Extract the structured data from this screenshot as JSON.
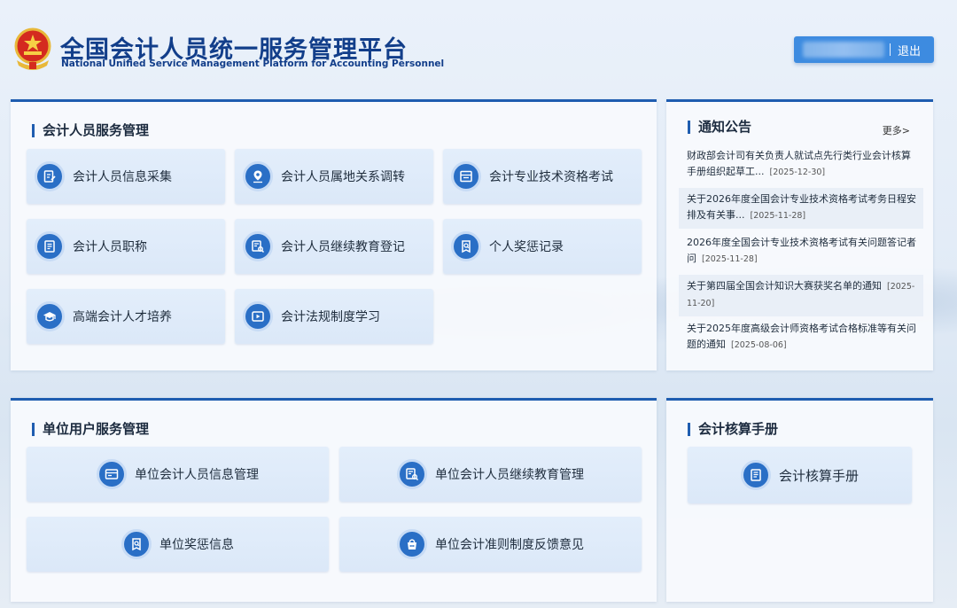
{
  "header": {
    "title_cn": "全国会计人员统一服务管理平台",
    "title_en": "National Unified Service Management Platform for Accounting Personnel",
    "logout": "退出"
  },
  "personal_services": {
    "title": "会计人员服务管理",
    "items": [
      {
        "label": "会计人员信息采集",
        "icon": "edit-document-icon"
      },
      {
        "label": "会计人员属地关系调转",
        "icon": "location-pin-icon"
      },
      {
        "label": "会计专业技术资格考试",
        "icon": "exam-icon"
      },
      {
        "label": "会计人员职称",
        "icon": "certificate-icon"
      },
      {
        "label": "会计人员继续教育登记",
        "icon": "document-search-icon"
      },
      {
        "label": "个人奖惩记录",
        "icon": "badge-search-icon"
      },
      {
        "label": "高端会计人才培养",
        "icon": "graduation-cap-icon"
      },
      {
        "label": "会计法规制度学习",
        "icon": "play-video-icon"
      }
    ]
  },
  "notices": {
    "title": "通知公告",
    "more": "更多>",
    "items": [
      {
        "text": "财政部会计司有关负责人就试点先行类行业会计核算手册组织起草工...",
        "date": "[2025-12-30]"
      },
      {
        "text": "关于2026年度全国会计专业技术资格考试考务日程安排及有关事...",
        "date": "[2025-11-28]"
      },
      {
        "text": "2026年度全国会计专业技术资格考试有关问题答记者问",
        "date": "[2025-11-28]"
      },
      {
        "text": "关于第四届全国会计知识大赛获奖名单的通知",
        "date": "[2025-11-20]"
      },
      {
        "text": "关于2025年度高级会计师资格考试合格标准等有关问题的通知",
        "date": "[2025-08-06]"
      }
    ]
  },
  "unit_services": {
    "title": "单位用户服务管理",
    "items": [
      {
        "label": "单位会计人员信息管理",
        "icon": "id-card-icon"
      },
      {
        "label": "单位会计人员继续教育管理",
        "icon": "document-search-icon"
      },
      {
        "label": "单位奖惩信息",
        "icon": "badge-search-icon"
      },
      {
        "label": "单位会计准则制度反馈意见",
        "icon": "feedback-bag-icon"
      }
    ]
  },
  "manual": {
    "title": "会计核算手册",
    "button": "会计核算手册",
    "icon": "manual-book-icon"
  },
  "colors": {
    "primary": "#1f5db0",
    "accent": "#3d8be0",
    "icon_bg": "#2a6fc6",
    "card_bg": "#dbe8f8"
  }
}
